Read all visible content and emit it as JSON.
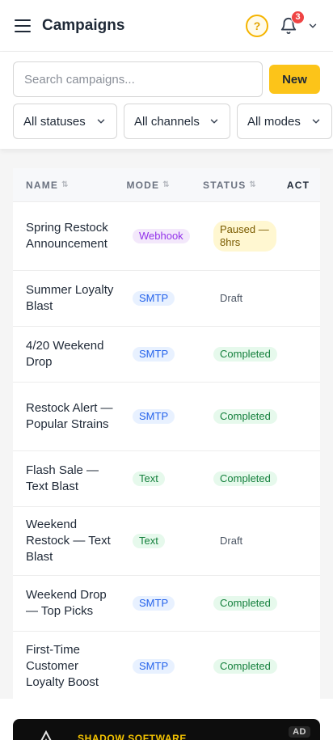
{
  "header": {
    "title": "Campaigns",
    "help_label": "?",
    "notification_count": "3"
  },
  "search": {
    "placeholder": "Search campaigns..."
  },
  "toolbar": {
    "new_label": "New"
  },
  "filters": {
    "status": "All statuses",
    "channels": "All channels",
    "modes": "All modes"
  },
  "table": {
    "columns": {
      "name": "NAME",
      "mode": "MODE",
      "status": "STATUS",
      "actions": "ACT"
    },
    "rows": [
      {
        "name": "Spring Restock Announcement",
        "mode": "Webhook",
        "status": "Paused — 8hrs"
      },
      {
        "name": "Summer Loyalty Blast",
        "mode": "SMTP",
        "status": "Draft"
      },
      {
        "name": "4/20 Weekend Drop",
        "mode": "SMTP",
        "status": "Completed"
      },
      {
        "name": "Restock Alert — Popular Strains",
        "mode": "SMTP",
        "status": "Completed"
      },
      {
        "name": "Flash Sale — Text Blast",
        "mode": "Text",
        "status": "Completed"
      },
      {
        "name": "Weekend Restock — Text Blast",
        "mode": "Text",
        "status": "Draft"
      },
      {
        "name": "Weekend Drop — Top Picks",
        "mode": "SMTP",
        "status": "Completed"
      },
      {
        "name": "First-Time Customer Loyalty Boost",
        "mode": "SMTP",
        "status": "Completed"
      }
    ]
  },
  "ad": {
    "brand": "SHADOW SOFTWARE",
    "tag": "AD"
  },
  "colors": {
    "accent": "#fcc419",
    "badge": "#ef4444"
  }
}
